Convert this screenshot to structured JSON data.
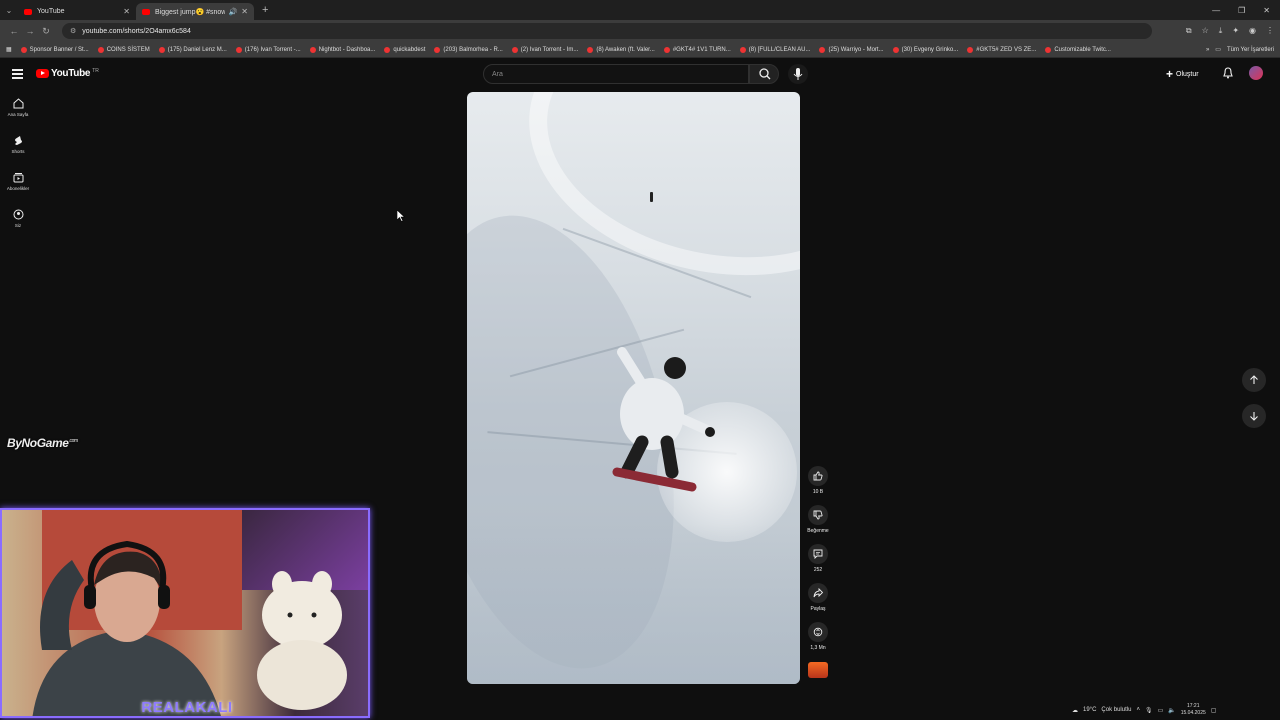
{
  "browser": {
    "tabs": [
      {
        "title": "YouTube",
        "active": false
      },
      {
        "title": "Biggest jump😮 #snowbo",
        "active": true
      }
    ],
    "url": "youtube.com/shorts/2O4amx6c584",
    "bookmarks": [
      "Sponsor Banner / St...",
      "COINS SİSTEM",
      "(175) Daniel Lenz M...",
      "(176) Ivan Torrent -...",
      "Nightbot - Dashboa...",
      "quickabdest",
      "(203) Balmorhea - R...",
      "(2) Ivan Torrent - Im...",
      "(8) Awaken (ft. Valer...",
      "#GKT4# 1V1 TURN...",
      "(8) [FULL/CLEAN AU...",
      "(25) Warriyo - Mort...",
      "(30) Evgeny Grinko...",
      "#GKT5# ZED VS ZE...",
      "Customizable Twitc..."
    ],
    "all_bookmarks": "Tüm Yer İşaretleri"
  },
  "youtube": {
    "logo_text": "YouTube",
    "region": "TR",
    "search_placeholder": "Ara",
    "create_label": "Oluştur",
    "sidebar": [
      {
        "label": "Ana Sayfa",
        "icon": "home-icon"
      },
      {
        "label": "Shorts",
        "icon": "shorts-icon"
      },
      {
        "label": "Abonelikler",
        "icon": "subscriptions-icon"
      },
      {
        "label": "Siz",
        "icon": "you-icon"
      }
    ],
    "actions": {
      "likes": "10 B",
      "dislike_label": "Beğenme",
      "comments": "252",
      "share_label": "Paylaş",
      "remix_count": "1,3 Mn"
    }
  },
  "overlay": {
    "watermark": "ByNoGame",
    "watermark_suffix": ".com",
    "streamer_name": "REALAKALI"
  },
  "taskbar": {
    "weather": "19°C",
    "weather_desc": "Çok bulutlu",
    "time": "17:21",
    "date": "15.04.2025"
  },
  "colors": {
    "youtube_red": "#ff0000",
    "background": "#0f0f0f",
    "webcam_border": "#8a6cff"
  }
}
